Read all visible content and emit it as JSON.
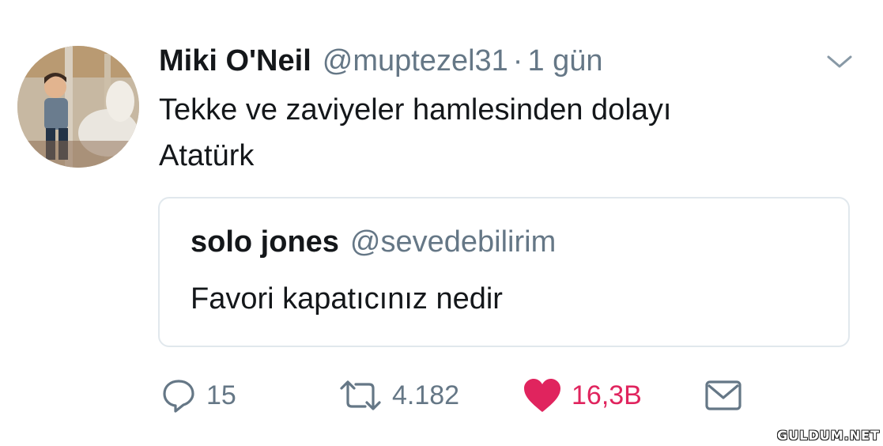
{
  "tweet": {
    "display_name": "Miki O'Neil",
    "handle": "@muptezel31",
    "separator": "·",
    "time": "1 gün",
    "text_lines": [
      "Tekke ve zaviyeler hamlesinden dolayı",
      "Atatürk"
    ],
    "avatar_icon": "profile-photo"
  },
  "quote": {
    "display_name": "solo jones",
    "handle": "@sevedebilirim",
    "text": "Favori kapatıcınız nedir"
  },
  "actions": {
    "reply_count": "15",
    "retweet_count": "4.182",
    "like_count": "16,3B",
    "reply_icon": "reply-icon",
    "retweet_icon": "retweet-icon",
    "like_icon": "heart-icon",
    "dm_icon": "envelope-icon"
  },
  "watermark": "GULDUM.NET",
  "colors": {
    "text": "#14171a",
    "secondary": "#657786",
    "like": "#e0245e",
    "border": "#e1e8ed"
  }
}
